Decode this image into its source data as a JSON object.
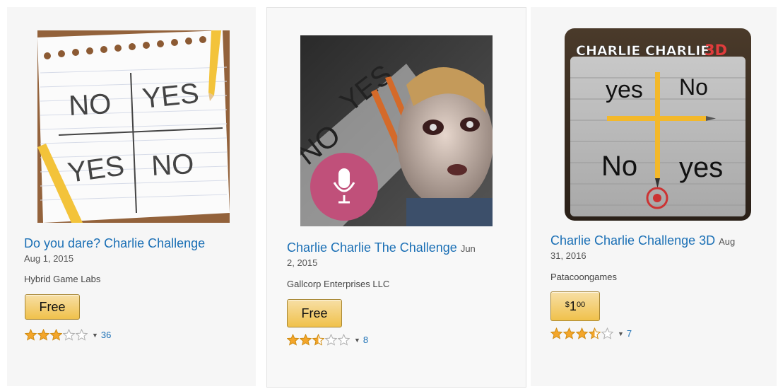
{
  "products": [
    {
      "title": "Do you dare? Charlie Challenge",
      "date": "Aug 1, 2015",
      "publisher": "Hybrid Game Labs",
      "price": "Free",
      "rating": 3,
      "review_count": "36",
      "image_icon": "paper-grid-no-yes-icon",
      "image_words": [
        "NO",
        "YES",
        "YES",
        "NO"
      ]
    },
    {
      "title": "Charlie Charlie The Challenge",
      "date_part1": "Jun",
      "date_part2": "2, 2015",
      "publisher": "Gallcorp Enterprises LLC",
      "price": "Free",
      "rating": 2.5,
      "review_count": "8",
      "image_icon": "ghost-boy-microphone-icon",
      "image_words": [
        "NO",
        "YES"
      ]
    },
    {
      "title": "Charlie Charlie Challenge 3D",
      "date_part1": "Aug",
      "date_part2": "31, 2016",
      "publisher": "Patacoongames",
      "price_symbol": "$",
      "price_whole": "1",
      "price_fraction": "00",
      "rating": 3.5,
      "review_count": "7",
      "image_icon": "pencil-cross-3d-icon",
      "image_header": "CHARLIE CHARLIE",
      "image_header_3d": "3D",
      "image_words": [
        "yes",
        "No",
        "No",
        "yes"
      ]
    }
  ],
  "colors": {
    "link": "#1a6fb5",
    "star": "#f4a62a",
    "button": "#f0c14b"
  }
}
